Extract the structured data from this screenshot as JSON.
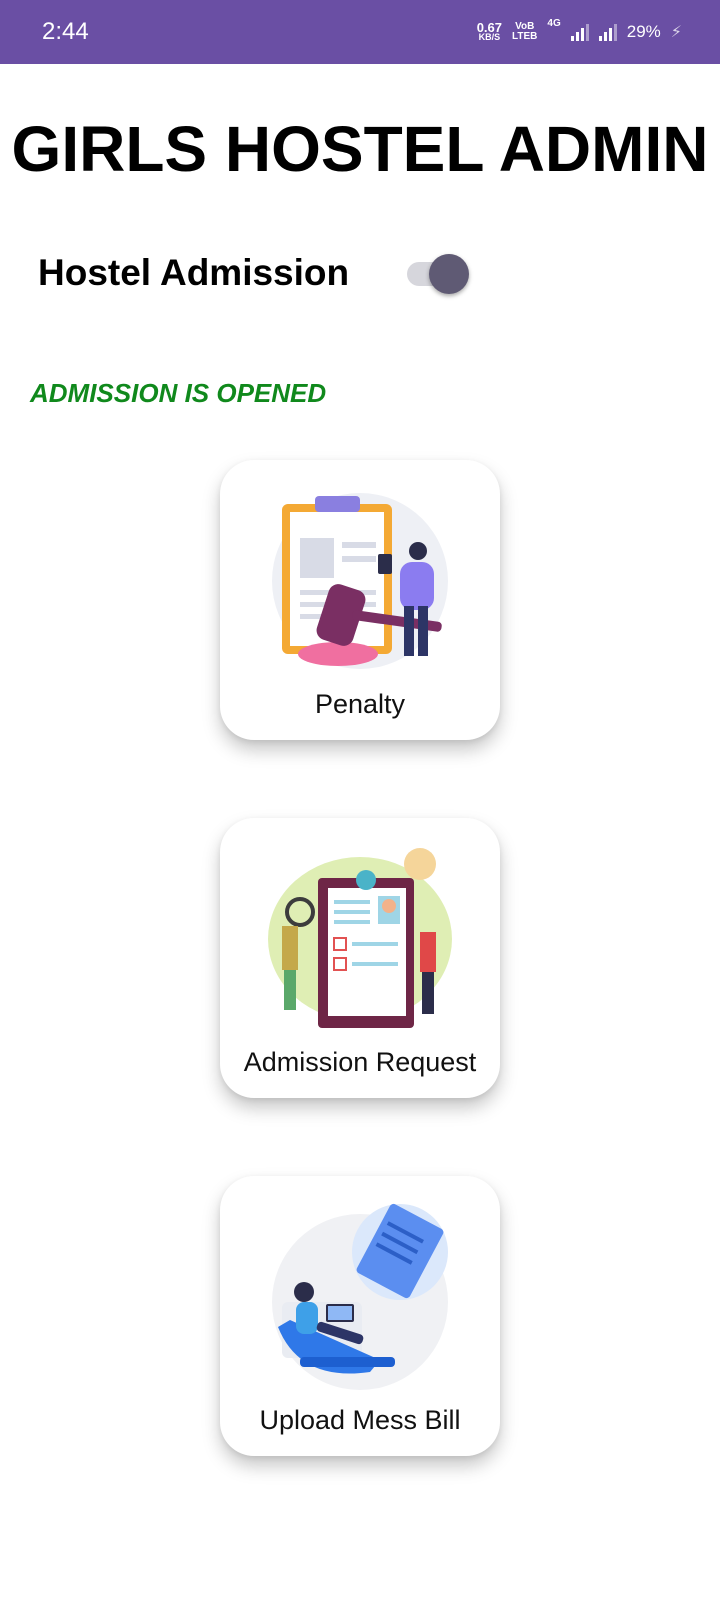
{
  "status_bar": {
    "time": "2:44",
    "speed_value": "0.67",
    "speed_unit": "KB/S",
    "volte_top": "VoB",
    "volte_bottom": "LTEB",
    "network": "4G",
    "battery": "29%"
  },
  "header": {
    "title": "GIRLS HOSTEL ADMIN"
  },
  "admission": {
    "label": "Hostel Admission",
    "toggle_on": true,
    "status": "ADMISSION IS OPENED",
    "status_color": "#10891c"
  },
  "cards": [
    {
      "label": "Penalty",
      "icon": "penalty-gavel-illustration"
    },
    {
      "label": "Admission Request",
      "icon": "admission-resume-illustration"
    },
    {
      "label": "Upload Mess Bill",
      "icon": "upload-document-illustration"
    }
  ],
  "colors": {
    "status_bar": "#6a4fa4",
    "accent_text": "#10891c"
  }
}
